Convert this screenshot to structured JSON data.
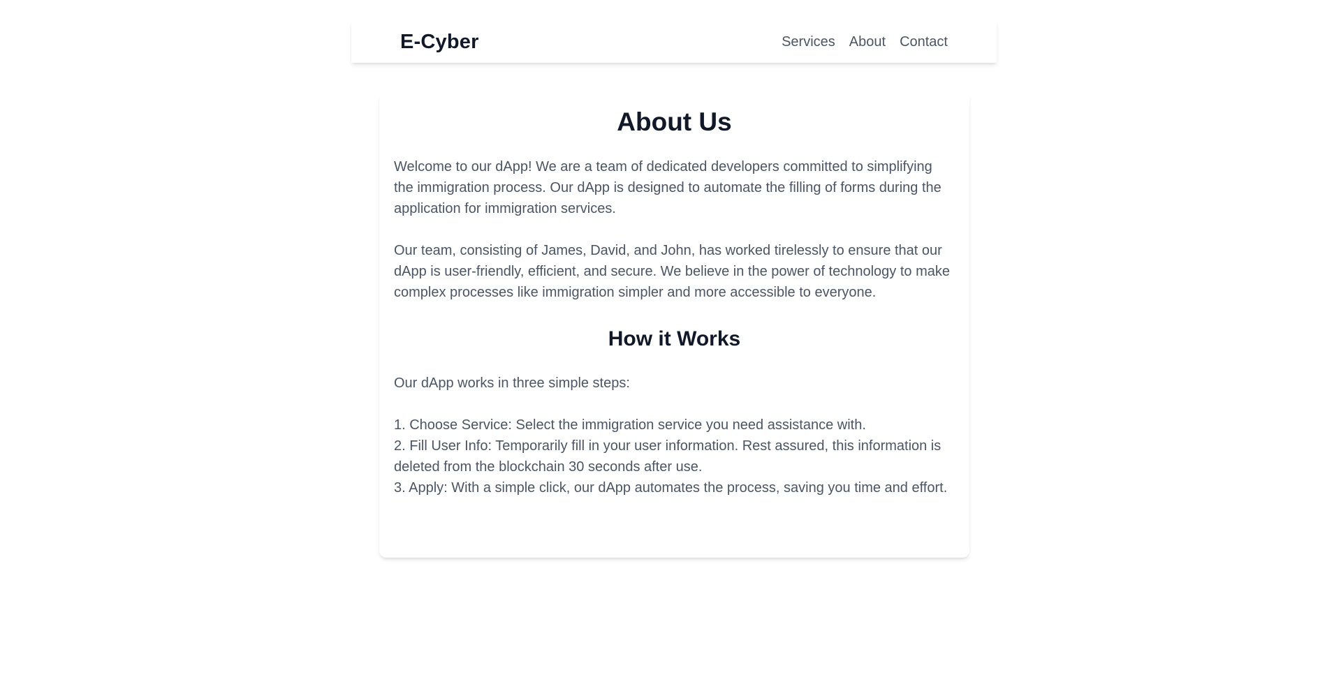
{
  "header": {
    "brand": "E-Cyber",
    "nav": [
      {
        "label": "Services"
      },
      {
        "label": "About"
      },
      {
        "label": "Contact"
      }
    ]
  },
  "main": {
    "title": "About Us",
    "intro_paragraphs": [
      "Welcome to our dApp! We are a team of dedicated developers committed to simplifying the immigration process. Our dApp is designed to automate the filling of forms during the application for immigration services.",
      "Our team, consisting of James, David, and John, has worked tirelessly to ensure that our dApp is user-friendly, efficient, and secure. We believe in the power of technology to make complex processes like immigration simpler and more accessible to everyone."
    ],
    "how_title": "How it Works",
    "how_intro": "Our dApp works in three simple steps:",
    "steps": [
      "1. Choose Service: Select the immigration service you need assistance with.",
      "2. Fill User Info: Temporarily fill in your user information. Rest assured, this information is deleted from the blockchain 30 seconds after use.",
      "3. Apply: With a simple click, our dApp automates the process, saving you time and effort."
    ]
  },
  "colors": {
    "heading": "#111827",
    "body_text": "#4b5563",
    "background": "#ffffff"
  }
}
